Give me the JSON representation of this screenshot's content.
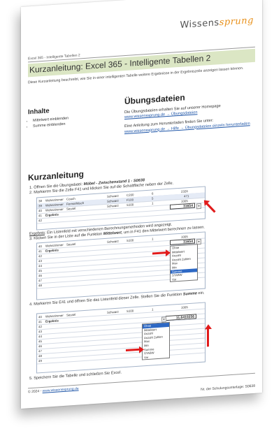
{
  "logo": {
    "text": "Wissens",
    "swirl": "sprung"
  },
  "breadcrumb": "Excel 365 - Intelligente Tabellen 2",
  "title": "Kurzanleitung: Excel 365 - Intelligente Tabellen 2",
  "intro": "Diese Kurzanleitung beschreibt, wie Sie in einer intelligenten Tabelle weitere Ergebnisse in der Ergebniszeile anzeigen lassen können.",
  "contents": {
    "heading": "Inhalte",
    "items": [
      "Mittelwert einblenden",
      "Summe einblenden"
    ]
  },
  "exercise": {
    "heading": "Übungsdateien",
    "text1": "Die Übungsdateien erhalten Sie auf unserer Homepage",
    "link1": "www.wissenssprung.de → Übungsdateien",
    "text2": "Eine Anleitung zum Herunterladen finden Sie unter:",
    "link2": "www.wissenssprung.de → Hilfe → Übungsdateien einzeln herunterladen"
  },
  "guide": {
    "heading": "Kurzanleitung",
    "step1_prefix": "1.  Öffnen Sie die Übungsdatei:",
    "step1_file": "Möbel - Zwischenstand 1 - S0638",
    "step2": "2.  Markieren Sie die Zelle F41 und klicken Sie auf die Schaltfläche neben der Zelle.",
    "result_label": "Ergebnis",
    "result_text": ": Ein Listenfeld mit verschiedenen Berechnungsmethoden wird angezeigt.",
    "step3_prefix": "3.  Klicken Sie in der Liste auf die Funktion",
    "step3_func": "Mittelwert",
    "step3_suffix": ", um in F41 den Mittelwert berechnen zu lassen.",
    "step4_prefix": "4.  Markieren Sie E41 und öffnen Sie das Listenfeld dieser Zelle. Stellen Sie die Funktion",
    "step4_func": "Summe",
    "step4_suffix": "ein.",
    "step5": "5.  Speichern Sie die Tabelle und schließen Sie Excel."
  },
  "shot1": {
    "rows": [
      {
        "n": "38",
        "a": "Wohnzimmer",
        "b": "Couch",
        "c": "Schwarz",
        "d": "C200",
        "e": "6",
        "f": "2326"
      },
      {
        "n": "39",
        "a": "Wohnzimmer",
        "b": "Fernsehtisch",
        "c": "Schwarz",
        "d": "F100",
        "e": "5",
        "f": "471"
      },
      {
        "n": "40",
        "a": "Wohnzimmer",
        "b": "Sessel",
        "c": "Schwarz",
        "d": "S100",
        "e": "1",
        "f": "1005"
      }
    ],
    "result_row": {
      "n": "41",
      "label": "Ergebnis",
      "value": "31654"
    },
    "empty_row": "42"
  },
  "shot2": {
    "row1": {
      "n": "40",
      "a": "Wohnzimmer",
      "b": "Sessel",
      "c": "Schwarz",
      "d": "S100",
      "e": "1",
      "f": "1005"
    },
    "row2": {
      "n": "41",
      "label": "Ergebnis",
      "value": "31654"
    },
    "more_rows": [
      "42",
      "43",
      "44",
      "45",
      "46",
      "47",
      "48"
    ],
    "options": [
      "Ohne",
      "Mittelwert",
      "Anzahl",
      "Anzahl Zahlen",
      "Max",
      "Min",
      "Summe",
      "STABW",
      "Var"
    ],
    "selected": 6
  },
  "shot3": {
    "row1": {
      "n": "40",
      "a": "Wohnzimmer",
      "b": "Sessel",
      "c": "Schwarz",
      "d": "S100",
      "e": "1",
      "f": "1005"
    },
    "row2": {
      "n": "41",
      "label": "Ergebnis"
    },
    "result_value": "11,6410256",
    "more_rows": [
      "42",
      "43",
      "44",
      "45",
      "46",
      "47",
      "48",
      "49"
    ],
    "options": [
      "Ohne",
      "Mittelwert",
      "Anzahl",
      "Anzahl Zahlen",
      "Max",
      "Min",
      "Summe",
      "STABW",
      "Var"
    ],
    "selected": 0
  },
  "footer": {
    "copyright": "© 2024 - ",
    "link": "www.wissenssprung.de",
    "number": "Nr. der Schulungsunterlage: S0638"
  }
}
